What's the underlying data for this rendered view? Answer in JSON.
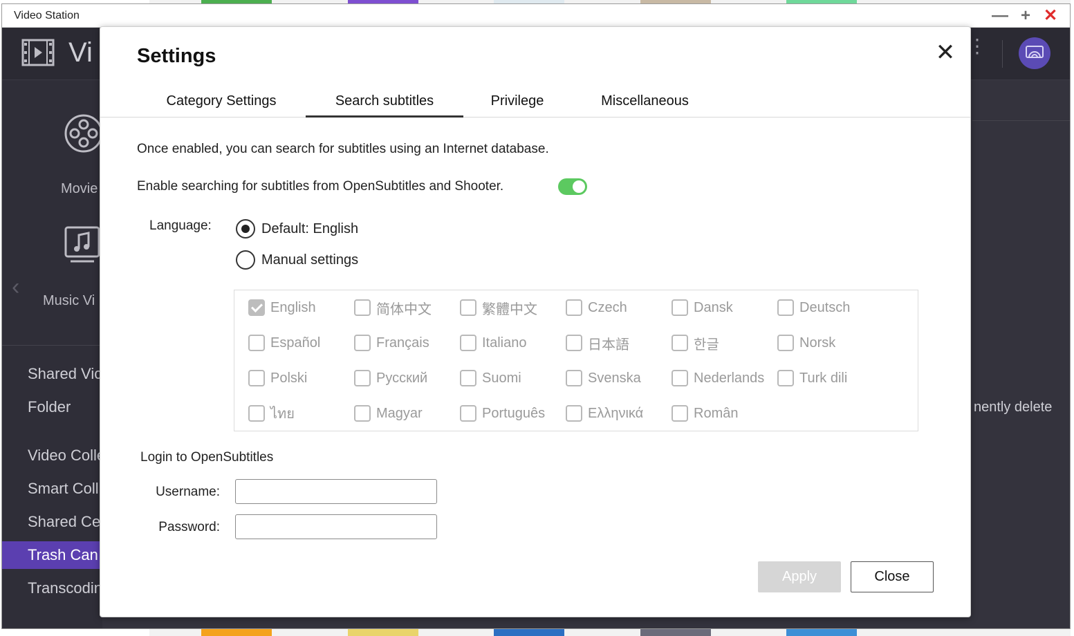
{
  "window": {
    "title": "Video Station",
    "minimize_glyph": "—",
    "maximize_glyph": "+",
    "close_glyph": "✕"
  },
  "app": {
    "name_visible": "Vi",
    "sidebar": {
      "categories": [
        {
          "label": "Movie",
          "icon": "film-reel-icon"
        },
        {
          "label": "Music Vi",
          "icon": "music-video-icon"
        }
      ],
      "items": [
        {
          "label": "Shared Vic"
        },
        {
          "label": "Folder"
        },
        {
          "label": "Video Colle"
        },
        {
          "label": "Smart Coll"
        },
        {
          "label": "Shared Ce"
        },
        {
          "label": "Trash Can",
          "active": true
        },
        {
          "label": "Transcodin"
        }
      ]
    },
    "background_text": "nently delete"
  },
  "dialog": {
    "title": "Settings",
    "close_glyph": "✕",
    "tabs": [
      {
        "label": "Category Settings"
      },
      {
        "label": "Search subtitles",
        "active": true
      },
      {
        "label": "Privilege"
      },
      {
        "label": "Miscellaneous"
      }
    ],
    "description": "Once enabled, you can search for subtitles using an Internet database.",
    "enable_label": "Enable searching for subtitles from OpenSubtitles and Shooter.",
    "enable_on": true,
    "language_label": "Language:",
    "radio_default": "Default: English",
    "radio_manual": "Manual settings",
    "selected_radio": "default",
    "languages": [
      {
        "label": "English",
        "checked": true
      },
      {
        "label": "简体中文",
        "checked": false
      },
      {
        "label": "繁體中文",
        "checked": false
      },
      {
        "label": "Czech",
        "checked": false
      },
      {
        "label": "Dansk",
        "checked": false
      },
      {
        "label": "Deutsch",
        "checked": false
      },
      {
        "label": "Español",
        "checked": false
      },
      {
        "label": "Français",
        "checked": false
      },
      {
        "label": "Italiano",
        "checked": false
      },
      {
        "label": "日本語",
        "checked": false
      },
      {
        "label": "한글",
        "checked": false
      },
      {
        "label": "Norsk",
        "checked": false
      },
      {
        "label": "Polski",
        "checked": false
      },
      {
        "label": "Русский",
        "checked": false
      },
      {
        "label": "Suomi",
        "checked": false
      },
      {
        "label": "Svenska",
        "checked": false
      },
      {
        "label": "Nederlands",
        "checked": false
      },
      {
        "label": "Turk dili",
        "checked": false
      },
      {
        "label": "ไทย",
        "checked": false
      },
      {
        "label": "Magyar",
        "checked": false
      },
      {
        "label": "Português",
        "checked": false
      },
      {
        "label": "Ελληνικά",
        "checked": false
      },
      {
        "label": "Român",
        "checked": false
      }
    ],
    "login_title": "Login to OpenSubtitles",
    "username_label": "Username:",
    "username_value": "",
    "password_label": "Password:",
    "password_value": "",
    "apply_label": "Apply",
    "close_label": "Close"
  },
  "colors": {
    "accent": "#5b3fb0",
    "toggle_on": "#5cc960",
    "window_close": "#e02b2b"
  }
}
